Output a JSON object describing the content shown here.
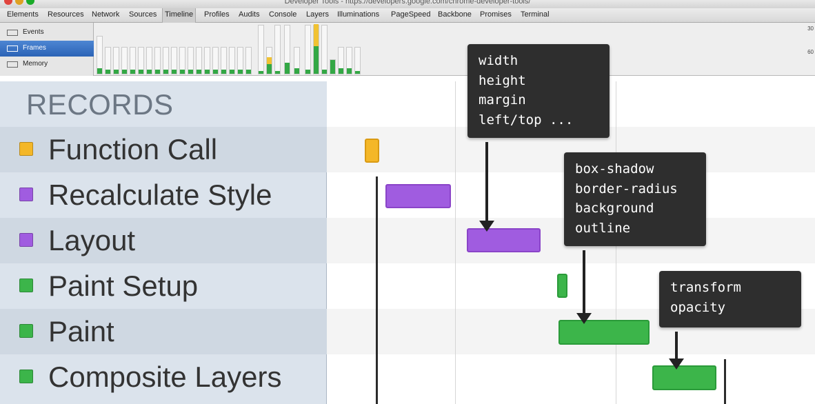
{
  "window": {
    "title": "Developer Tools - https://developers.google.com/chrome-developer-tools/"
  },
  "tabs": [
    {
      "label": "Elements"
    },
    {
      "label": "Resources"
    },
    {
      "label": "Network"
    },
    {
      "label": "Sources"
    },
    {
      "label": "Timeline",
      "active": true
    },
    {
      "label": "Profiles"
    },
    {
      "label": "Audits"
    },
    {
      "label": "Console"
    },
    {
      "label": "Layers"
    },
    {
      "label": "Illuminations"
    },
    {
      "label": "PageSpeed"
    },
    {
      "label": "Backbone"
    },
    {
      "label": "Promises"
    },
    {
      "label": "Terminal"
    }
  ],
  "overview": {
    "modes": [
      {
        "label": "Events",
        "icon": "events-icon"
      },
      {
        "label": "Frames",
        "icon": "frames-icon",
        "selected": true
      },
      {
        "label": "Memory",
        "icon": "memory-icon"
      }
    ],
    "scale_top": "30",
    "scale_mid": "60"
  },
  "records": {
    "title": "RECORDS",
    "items": [
      {
        "label": "Function Call",
        "color": "#f4b728"
      },
      {
        "label": "Recalculate Style",
        "color": "#a05ce0"
      },
      {
        "label": "Layout",
        "color": "#a05ce0"
      },
      {
        "label": "Paint Setup",
        "color": "#3cb54a"
      },
      {
        "label": "Paint",
        "color": "#3cb54a"
      },
      {
        "label": "Composite Layers",
        "color": "#3cb54a"
      }
    ]
  },
  "callouts": {
    "layout": {
      "lines": [
        "width",
        "height",
        "margin",
        "left/top ..."
      ]
    },
    "paint": {
      "lines": [
        "box-shadow",
        "border-radius",
        "background",
        "outline"
      ]
    },
    "composite": {
      "lines": [
        "transform",
        "opacity"
      ]
    }
  },
  "colors": {
    "function_call": "#f4b728",
    "style_layout": "#a05ce0",
    "paint": "#3cb54a",
    "selected_mode": "#2b63b6"
  }
}
